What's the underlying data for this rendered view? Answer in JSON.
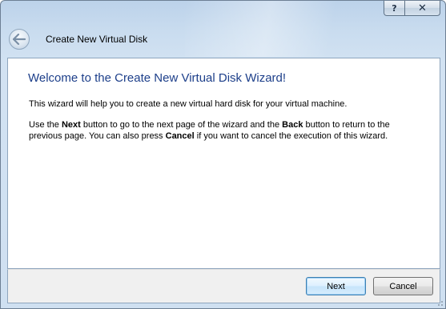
{
  "titlebar": {
    "help_label": "?",
    "close_label": "✕"
  },
  "header": {
    "back_icon": "back-arrow-icon",
    "title": "Create New Virtual Disk"
  },
  "content": {
    "heading": "Welcome to the Create New Virtual Disk Wizard!",
    "paragraph1": "This wizard will help you to create a new virtual hard disk for your virtual machine.",
    "paragraph2": {
      "t1": "Use the ",
      "b1": "Next",
      "t2": " button to go to the next page of the wizard and the ",
      "b2": "Back",
      "t3": " button to return to the previous page. You can also press ",
      "b3": "Cancel",
      "t4": " if you want to cancel the execution of this wizard."
    }
  },
  "footer": {
    "next_label": "Next",
    "cancel_label": "Cancel"
  },
  "colors": {
    "heading": "#1d3f8a",
    "frame": "#cfe0f1",
    "default_button_border": "#3c7fb1"
  }
}
